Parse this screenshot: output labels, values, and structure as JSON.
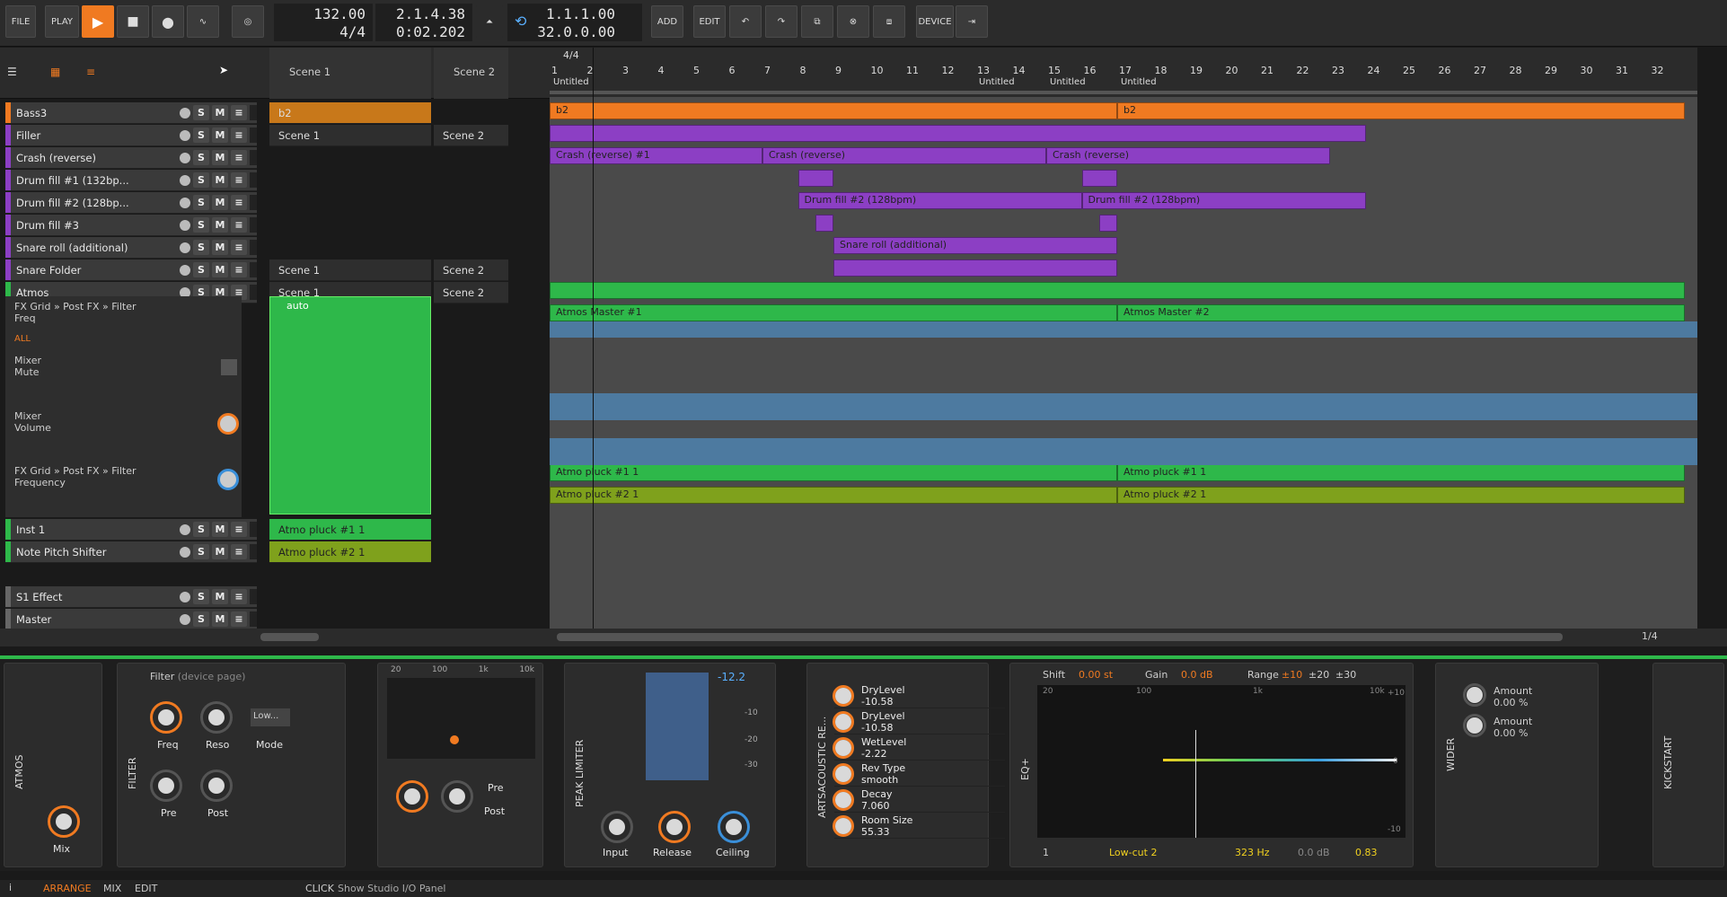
{
  "toolbar": {
    "file": "FILE",
    "play": "PLAY",
    "tempo": "132.00",
    "time_sig": "4/4",
    "position_bars": "2.1.4.38",
    "position_time": "0:02.202",
    "loop_start": "1.1.1.00",
    "loop_length": "32.0.0.00",
    "add": "ADD",
    "edit": "EDIT",
    "device": "DEVICE"
  },
  "colors": {
    "orange": "#f07a21",
    "purple": "#8c3fc4",
    "green": "#2eb84a",
    "olive": "#7fa11c",
    "blue": "#4d7aa0"
  },
  "launcher_header": {
    "scene1": "Scene 1",
    "scene2": "Scene 2"
  },
  "tracks": [
    {
      "name": "Bass3",
      "color": "#f07a21",
      "launch1": "b2",
      "launch2": ""
    },
    {
      "name": "Filler",
      "color": "#8c3fc4",
      "launch1": "Scene 1",
      "launch2": "Scene 2"
    },
    {
      "name": "Crash (reverse)",
      "color": "#8c3fc4",
      "launch1": "",
      "launch2": ""
    },
    {
      "name": "Drum fill #1 (132bp...",
      "color": "#8c3fc4",
      "launch1": "",
      "launch2": ""
    },
    {
      "name": "Drum fill #2 (128bp...",
      "color": "#8c3fc4",
      "launch1": "",
      "launch2": ""
    },
    {
      "name": "Drum fill #3",
      "color": "#8c3fc4",
      "launch1": "",
      "launch2": ""
    },
    {
      "name": "Snare roll (additional)",
      "color": "#8c3fc4",
      "launch1": "",
      "launch2": ""
    },
    {
      "name": "Snare Folder",
      "color": "#8c3fc4",
      "launch1": "Scene 1",
      "launch2": "Scene 2"
    },
    {
      "name": "Atmos",
      "color": "#2eb84a",
      "launch1": "Scene 1",
      "launch2": "Scene 2"
    }
  ],
  "automation": {
    "param1_path": "FX Grid » Post FX » Filter",
    "param1_name": "Freq",
    "all": "ALL",
    "lanes": [
      {
        "group": "Mixer",
        "name": "Mute"
      },
      {
        "group": "Mixer",
        "name": "Volume"
      },
      {
        "group": "FX Grid » Post FX » Filter",
        "name": "Frequency"
      }
    ],
    "auto_clip": "auto"
  },
  "lower_tracks": [
    {
      "name": "Inst 1",
      "clip": "Atmo pluck #1 1"
    },
    {
      "name": "Note Pitch Shifter",
      "clip": "Atmo pluck #2 1"
    },
    {
      "name": "S1 Effect",
      "clip": ""
    },
    {
      "name": "Master",
      "clip": ""
    }
  ],
  "ruler": {
    "signature": "4/4",
    "marker": "Untitled",
    "numbers": [
      "1",
      "2",
      "3",
      "4",
      "5",
      "6",
      "7",
      "8",
      "9",
      "10",
      "11",
      "12",
      "13",
      "14",
      "15",
      "16",
      "17",
      "18",
      "19",
      "20",
      "21",
      "22",
      "23",
      "24",
      "25",
      "26",
      "27",
      "28",
      "29",
      "30",
      "31",
      "32"
    ]
  },
  "clips": {
    "bass_b2a": "b2",
    "bass_b2b": "b2",
    "crash1": "Crash (reverse) #1",
    "crash2": "Crash (reverse)",
    "crash3": "Crash (reverse)",
    "drumfill2a": "Drum fill #2 (128bpm)",
    "drumfill2b": "Drum fill #2 (128bpm)",
    "snareroll": "Snare roll (additional)",
    "atmos1": "Atmos Master #1",
    "atmos2": "Atmos Master #2",
    "pluck1a": "Atmo pluck #1 1",
    "pluck1b": "Atmo pluck #1 1",
    "pluck2a": "Atmo pluck #2 1",
    "pluck2b": "Atmo pluck #2 1"
  },
  "zoom": "1/4",
  "devices": {
    "atmos_label": "ATMOS",
    "mix": "Mix",
    "filter_label": "FILTER",
    "filter_title": "Filter",
    "filter_sub": "(device page)",
    "freq": "Freq",
    "reso": "Reso",
    "mode": "Mode",
    "mode_value": "Low...",
    "pre": "Pre",
    "post": "Post",
    "spec_ticks": [
      "20",
      "100",
      "1k",
      "10k"
    ],
    "pre2": "Pre",
    "post2": "Post",
    "peak_label": "PEAK LIMITER",
    "peak_value": "-12.2",
    "peak_scale": [
      "-10",
      "-20",
      "-30"
    ],
    "input": "Input",
    "release": "Release",
    "ceiling": "Ceiling",
    "arts_label": "ARTSACOUSTIC RE...",
    "reverb_params": [
      {
        "name": "DryLevel",
        "value": "-10.58"
      },
      {
        "name": "DryLevel",
        "value": "-10.58"
      },
      {
        "name": "WetLevel",
        "value": "-2.22"
      },
      {
        "name": "Rev Type",
        "value": "smooth"
      },
      {
        "name": "Decay",
        "value": "7.060"
      },
      {
        "name": "Room Size",
        "value": "55.33"
      }
    ],
    "eq_label": "EQ+",
    "shift": "Shift",
    "shift_value": "0.00 st",
    "gain": "Gain",
    "gain_value": "0.0 dB",
    "range": "Range",
    "range_opts": [
      "±10",
      "±20",
      "±30"
    ],
    "eq_ticks": [
      "20",
      "100",
      "1k",
      "10k"
    ],
    "eq_right": [
      "+10",
      "0",
      "-10"
    ],
    "band": "1",
    "band_type": "Low-cut 2",
    "band_freq": "323 Hz",
    "band_gain": "0.0 dB",
    "band_q": "0.83",
    "wider_label": "WIDER",
    "amount1": "Amount",
    "amount1_value": "0.00 %",
    "amount2": "Amount",
    "amount2_value": "0.00 %",
    "kick_label": "KICKSTART"
  },
  "status": {
    "arrange": "ARRANGE",
    "mix": "MIX",
    "edit": "EDIT",
    "click": "CLICK",
    "hint": "Show Studio I/O Panel"
  }
}
